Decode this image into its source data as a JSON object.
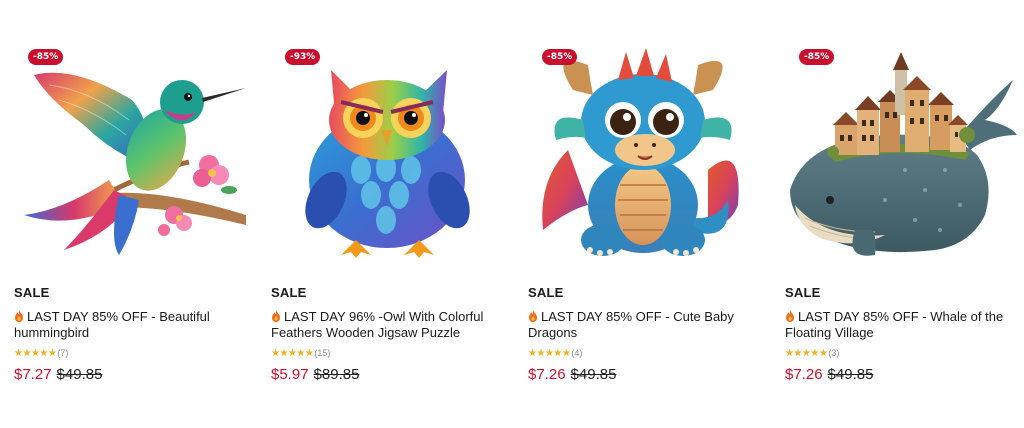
{
  "colors": {
    "sale_red": "#c8102e",
    "star_gold": "#f2b01e",
    "text": "#1a1a1a"
  },
  "products": [
    {
      "badge": "-85%",
      "sale_label": "SALE",
      "title": "LAST DAY 85% OFF - Beautiful hummingbird",
      "title_icon": "fire-icon",
      "stars": "★★★★★",
      "rating": 5,
      "reviews": "(7)",
      "price": "$7.27",
      "compare_price": "$49.85",
      "image": "hummingbird on a branch with pink flowers"
    },
    {
      "badge": "-93%",
      "sale_label": "SALE",
      "title": "LAST DAY 96% -Owl With Colorful Feathers Wooden Jigsaw Puzzle",
      "title_icon": "fire-icon",
      "stars": "★★★★★",
      "rating": 5,
      "reviews": "(15)",
      "price": "$5.97",
      "compare_price": "$89.85",
      "image": "colorful owl"
    },
    {
      "badge": "-85%",
      "sale_label": "SALE",
      "title": "LAST DAY 85% OFF - Cute Baby Dragons",
      "title_icon": "fire-icon",
      "stars": "★★★★★",
      "rating": 5,
      "reviews": "(4)",
      "price": "$7.26",
      "compare_price": "$49.85",
      "image": "cute baby dragon"
    },
    {
      "badge": "-85%",
      "sale_label": "SALE",
      "title": "LAST DAY 85% OFF - Whale of the Floating Village",
      "title_icon": "fire-icon",
      "stars": "★★★★★",
      "rating": 5,
      "reviews": "(3)",
      "price": "$7.26",
      "compare_price": "$49.85",
      "image": "whale carrying a village on its back"
    }
  ]
}
